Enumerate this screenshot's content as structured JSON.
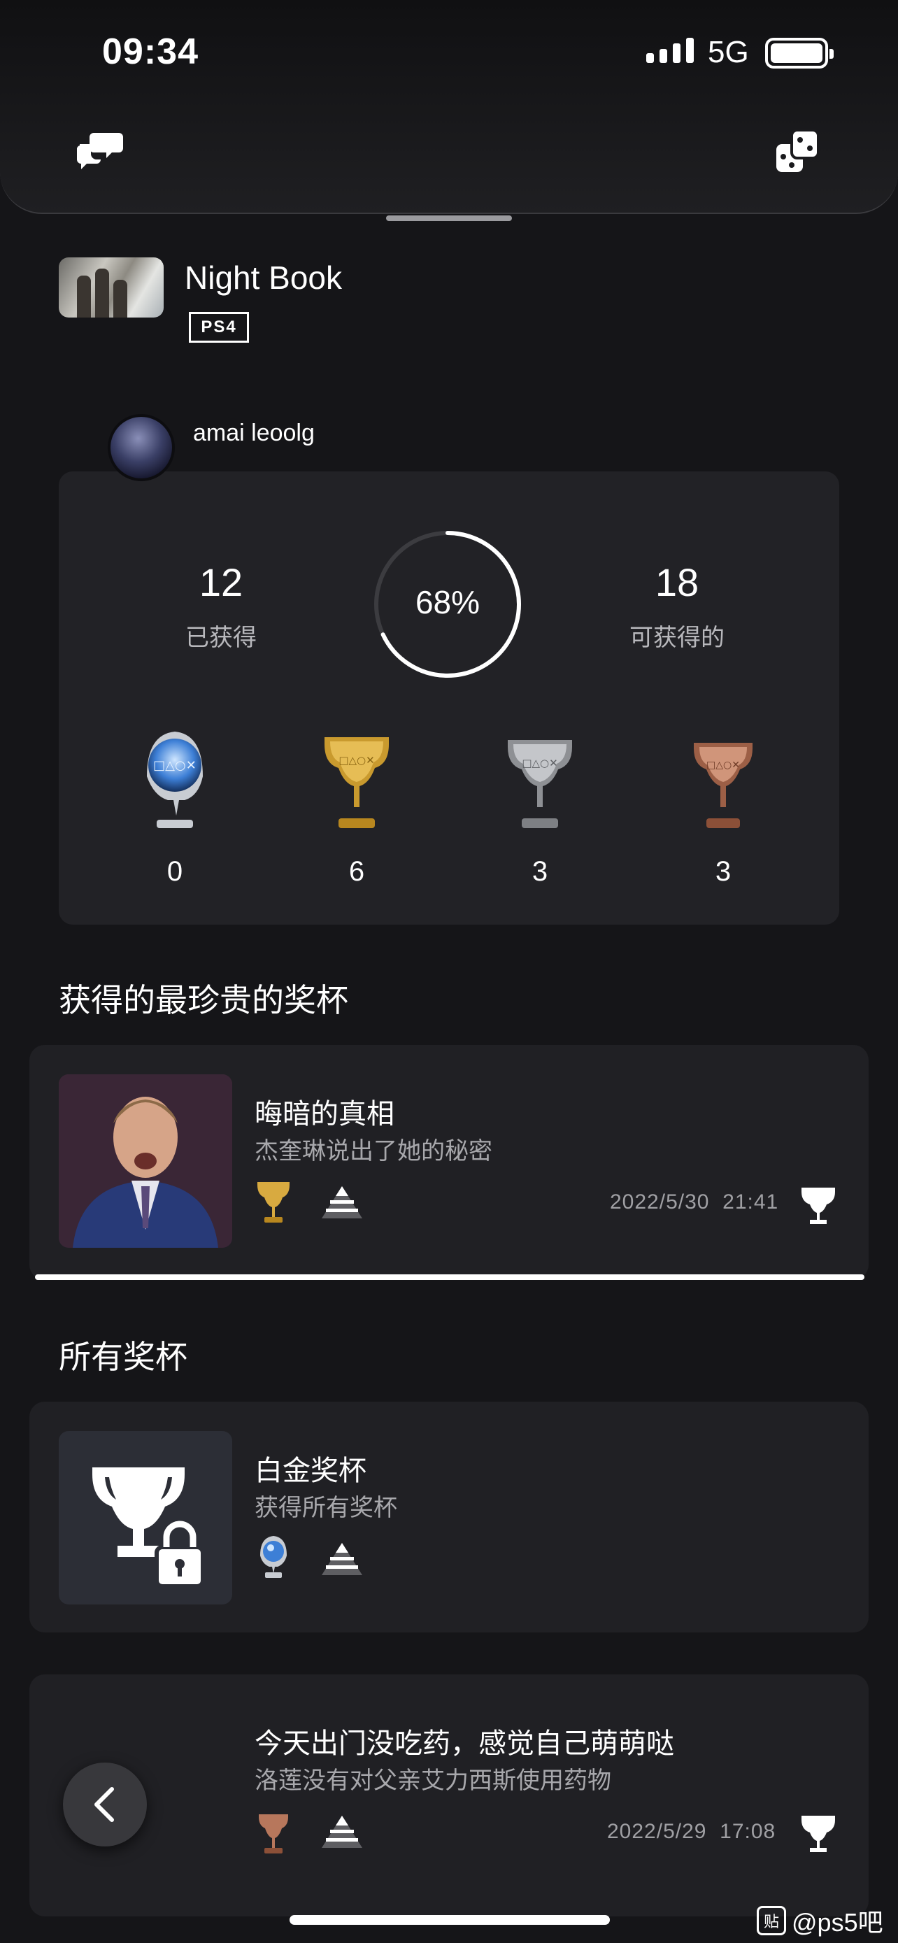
{
  "status_bar": {
    "time": "09:34",
    "network": "5G"
  },
  "game": {
    "title": "Night Book",
    "platform": "PS4"
  },
  "user": {
    "name": "amai leoolg"
  },
  "summary": {
    "earned_count": "12",
    "earned_label": "已获得",
    "progress_text": "68%",
    "progress_value": 0.68,
    "available_count": "18",
    "available_label": "可获得的"
  },
  "trophy_counts": [
    {
      "type": "platinum",
      "count": "0"
    },
    {
      "type": "gold",
      "count": "6"
    },
    {
      "type": "silver",
      "count": "3"
    },
    {
      "type": "bronze",
      "count": "3"
    }
  ],
  "rarest_section": {
    "title": "获得的最珍贵的奖杯",
    "trophy": {
      "name": "晦暗的真相",
      "description": "杰奎琳说出了她的秘密",
      "grade": "gold",
      "date": "2022/5/30",
      "time": "21:41"
    }
  },
  "all_section": {
    "title": "所有奖杯",
    "trophies": [
      {
        "name": "白金奖杯",
        "description": "获得所有奖杯",
        "grade": "platinum",
        "locked": true
      },
      {
        "name": "今天出门没吃药，感觉自己萌萌哒",
        "description": "洛莲没有对父亲艾力西斯使用药物",
        "grade": "bronze",
        "date": "2022/5/29",
        "time": "17:08"
      }
    ]
  },
  "watermark": {
    "icon_text": "贴",
    "text": "@ps5吧"
  },
  "colors": {
    "background": "#151518",
    "card": "#222226",
    "gold": "#c99a2e",
    "silver": "#9a9ca0",
    "bronze": "#b7775c",
    "platinum": "#6fa9e8"
  }
}
